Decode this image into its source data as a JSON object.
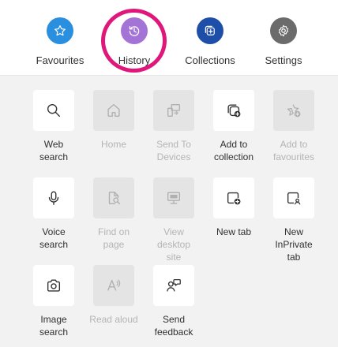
{
  "top_bar": {
    "items": [
      {
        "label": "Favourites",
        "icon": "star-icon",
        "color": "#2b8fe0"
      },
      {
        "label": "History",
        "icon": "history-icon",
        "color": "#a473d6"
      },
      {
        "label": "Collections",
        "icon": "collections-icon",
        "color": "#1e4fa8"
      },
      {
        "label": "Settings",
        "icon": "gear-icon",
        "color": "#6b6b6b"
      }
    ],
    "highlight_color": "#e0177a"
  },
  "actions": [
    {
      "label": "Web\nsearch",
      "icon": "search-icon",
      "enabled": true
    },
    {
      "label": "Home",
      "icon": "home-icon",
      "enabled": false
    },
    {
      "label": "Send To\nDevices",
      "icon": "send-to-devices-icon",
      "enabled": false
    },
    {
      "label": "Add to\ncollection",
      "icon": "add-to-collection-icon",
      "enabled": true
    },
    {
      "label": "Add to\nfavourites",
      "icon": "add-to-favourites-icon",
      "enabled": false
    },
    {
      "label": "Voice\nsearch",
      "icon": "microphone-icon",
      "enabled": true
    },
    {
      "label": "Find on\npage",
      "icon": "find-on-page-icon",
      "enabled": false
    },
    {
      "label": "View\ndesktop\nsite",
      "icon": "desktop-icon",
      "enabled": false
    },
    {
      "label": "New tab",
      "icon": "new-tab-icon",
      "enabled": true
    },
    {
      "label": "New\nInPrivate\ntab",
      "icon": "inprivate-tab-icon",
      "enabled": true
    },
    {
      "label": "Image\nsearch",
      "icon": "camera-icon",
      "enabled": true
    },
    {
      "label": "Read aloud",
      "icon": "read-aloud-icon",
      "enabled": false
    },
    {
      "label": "Send\nfeedback",
      "icon": "feedback-icon",
      "enabled": true
    }
  ]
}
